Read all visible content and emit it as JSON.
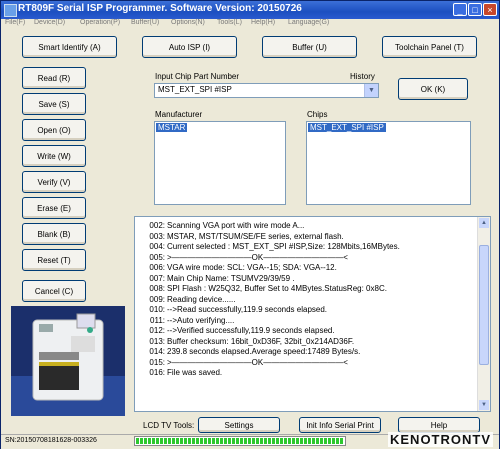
{
  "window": {
    "title": "RT809F Serial ISP Programmer. Software Version: 20150726",
    "controls": [
      "minimize",
      "maximize",
      "close"
    ]
  },
  "menu": [
    "File(F)",
    "Device(D)",
    "Operation(P)",
    "Buffer(U)",
    "Options(N)",
    "Tools(L)",
    "Help(H)",
    "Language(G)"
  ],
  "toolbar": {
    "smart_identify": "Smart Identify (A)",
    "auto_isp": "Auto ISP (I)",
    "buffer": "Buffer (U)",
    "toolchain": "Toolchain Panel (T)"
  },
  "side_buttons": [
    "Read (R)",
    "Save (S)",
    "Open (O)",
    "Write (W)",
    "Verify (V)",
    "Erase (E)",
    "Blank (B)",
    "Reset (T)"
  ],
  "cancel_label": "Cancel (C)",
  "chip": {
    "input_label": "Input Chip Part Number",
    "history_label": "History",
    "value": "MST_EXT_SPI #ISP",
    "ok_label": "OK (K)"
  },
  "manufacturer": {
    "label": "Manufacturer",
    "selected": "MSTAR"
  },
  "chips": {
    "label": "Chips",
    "selected": "MST_EXT_SPI #ISP"
  },
  "log": [
    {
      "n": "002:",
      "t": "Scanning VGA port with wire mode A..."
    },
    {
      "n": "003:",
      "t": "MSTAR, MST/TSUM/SE/FE series, external flash."
    },
    {
      "n": "004:",
      "t": "Current selected : MST_EXT_SPI #ISP,Size: 128Mbits,16MBytes."
    },
    {
      "n": "005:",
      "t": ">——————————OK——————————<"
    },
    {
      "n": "006:",
      "t": "VGA wire mode: SCL: VGA--15; SDA: VGA--12."
    },
    {
      "n": "007:",
      "t": "Main Chip Name: TSUMV29/39/59 ."
    },
    {
      "n": "008:",
      "t": "SPI Flash : W25Q32, Buffer Set to 4MBytes.StatusReg: 0x8C."
    },
    {
      "n": "009:",
      "t": "Reading device......"
    },
    {
      "n": "010:",
      "t": "-->Read successfully,119.9 seconds elapsed."
    },
    {
      "n": "011:",
      "t": "-->Auto verifying...."
    },
    {
      "n": "012:",
      "t": "-->Verified successfully,119.9 seconds elapsed."
    },
    {
      "n": "013:",
      "t": "Buffer checksum: 16bit_0xD36F, 32bit_0x214AD36F."
    },
    {
      "n": "014:",
      "t": "239.8 seconds elapsed.Average speed:17489 Bytes/s."
    },
    {
      "n": "015:",
      "t": ">——————————OK——————————<"
    },
    {
      "n": "016:",
      "t": "File was saved."
    }
  ],
  "bottom": {
    "lcd_label": "LCD TV Tools:",
    "settings": "Settings",
    "init_info": "Init Info Serial Print",
    "help": "Help"
  },
  "status": {
    "sn": "SN:20150708181628-003326",
    "progress": 1.0,
    "watermark": "KENOTRONTV"
  },
  "colors": {
    "title_bar": "#1c4fc0",
    "selection": "#316ac5",
    "progress": "#2ec82e"
  }
}
